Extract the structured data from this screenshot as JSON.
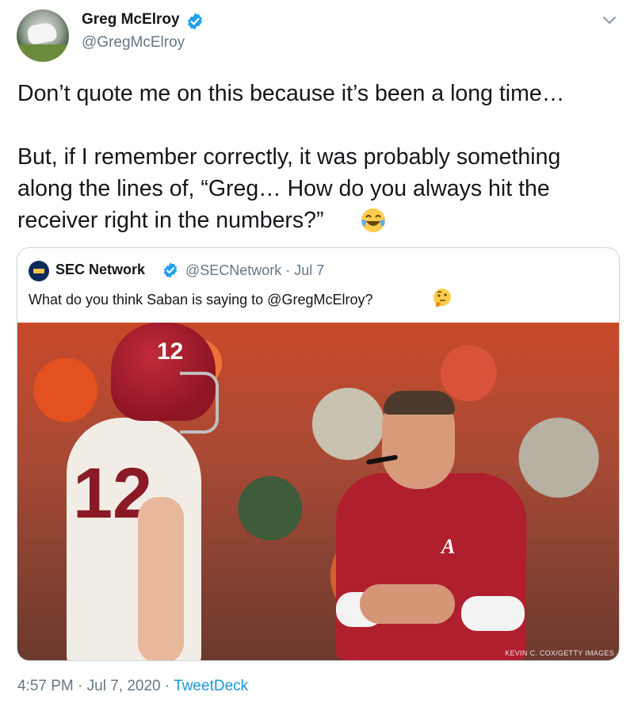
{
  "author": {
    "display_name": "Greg McElroy",
    "handle": "@GregMcElroy"
  },
  "tweet": {
    "text": "Don’t quote me on this because it’s been a long time…\n\nBut, if I remember correctly, it was probably something\nalong the lines of, “Greg… How do you always hit the\nreceiver right in the numbers?”",
    "emoji": "face-with-tears-of-joy"
  },
  "quoted_tweet": {
    "display_name": "SEC Network",
    "handle_and_date": "@SECNetwork · Jul 7",
    "text": "What do you think Saban is saying to @GregMcElroy?",
    "emoji": "thinking-face",
    "photo": {
      "description": "Alabama quarterback #12 talking with head coach on the sideline",
      "helmet_number": "12",
      "jersey_number": "12",
      "shirt_logo": "A",
      "credit": "KEVIN C. COX/GETTY IMAGES"
    }
  },
  "footer": {
    "time_date": "4:57 PM · Jul 7, 2020 · ",
    "source": "TweetDeck"
  },
  "colors": {
    "verified_blue": "#1da1f2",
    "link_blue": "#1b95e0",
    "secondary_text": "#657786",
    "border": "#ccd6dd"
  },
  "icons": [
    "verified-badge-icon",
    "chevron-down-icon"
  ]
}
